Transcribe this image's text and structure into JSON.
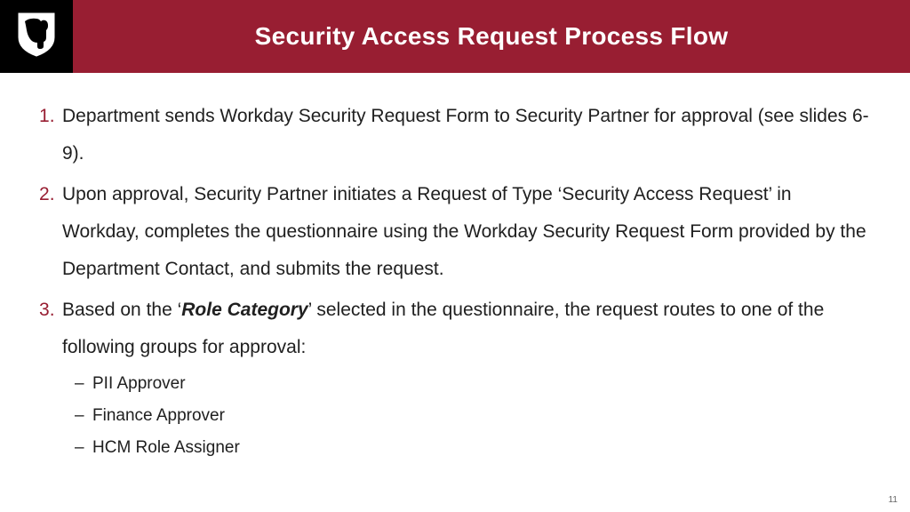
{
  "header": {
    "title": "Security Access Request Process Flow",
    "logo_icon": "cougar-shield-icon"
  },
  "list": {
    "items": [
      {
        "text": "Department sends Workday Security Request Form to Security Partner for approval (see slides 6-9)."
      },
      {
        "text": "Upon approval, Security Partner initiates a Request of Type ‘Security Access Request’ in Workday, completes the questionnaire using the Workday Security Request Form provided by the Department Contact, and submits the request."
      },
      {
        "pre": "Based on the ‘",
        "emph": "Role Category",
        "post": "’ selected in the questionnaire, the request routes to one of the following groups for approval:",
        "sub": [
          "PII Approver",
          "Finance Approver",
          "HCM Role Assigner"
        ]
      }
    ]
  },
  "page_number": "11",
  "colors": {
    "accent": "#981e32",
    "logo_bg": "#000000"
  }
}
